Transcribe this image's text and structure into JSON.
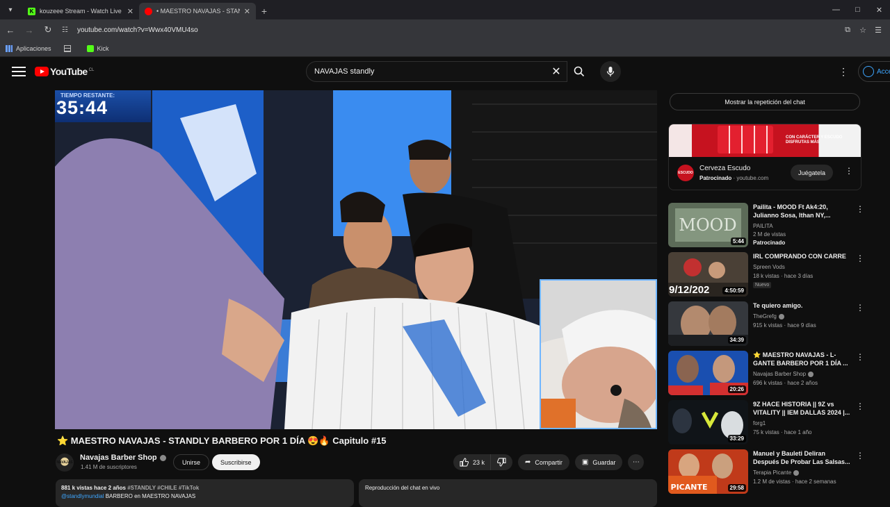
{
  "browser": {
    "tabs": [
      {
        "title": "kouzeee Stream - Watch Live o",
        "active": false
      },
      {
        "title": "• MAESTRO NAVAJAS - STANDL",
        "active": true
      }
    ],
    "url": "youtube.com/watch?v=Wwx40VMU4so",
    "bookmarks": [
      {
        "label": "Aplicaciones",
        "icon": "apps-icon"
      },
      {
        "label": "",
        "icon": "grid-icon"
      },
      {
        "label": "Kick",
        "icon": "kick-icon"
      }
    ]
  },
  "youtube": {
    "logo_text": "YouTube",
    "country": "CL",
    "search_value": "NAVAJAS standly",
    "signin_label": "Acce"
  },
  "video": {
    "timer_label": "TIEMPO RESTANTE:",
    "timer_value": "35:44",
    "title": "⭐ MAESTRO NAVAJAS - STANDLY BARBERO POR 1 DÍA 😍🔥 Capitulo #15",
    "channel": "Navajas Barber Shop",
    "subscribers": "1.41 M de suscriptores",
    "join_label": "Unirse",
    "subscribe_label": "Suscribirse",
    "likes": "23 k",
    "share_label": "Compartir",
    "save_label": "Guardar",
    "desc_meta": "881 k vistas  hace 2 años",
    "desc_tags": "#STANDLY #CHILE #TikTok",
    "desc_mention": "@standlymundial",
    "desc_rest": "BARBERO en MAESTRO NAVAJAS",
    "livechat_label": "Reproducción del chat en vivo"
  },
  "sidebar": {
    "chat_replay_label": "Mostrar la repetición del chat",
    "ad": {
      "banner_text": "CON CARÁCTER Y ESCUDO DISFRUTAS MÁS",
      "logo_text": "ESCUDO",
      "title": "Cerveza Escudo",
      "sponsored": "Patrocinado",
      "domain": "youtube.com",
      "cta": "Juégatela"
    },
    "recommendations": [
      {
        "title": "Pailita - MOOD Ft Ak4:20, Julianno Sosa, Ithan NY,...",
        "channel": "PAILITA",
        "meta": "2 M de vistas",
        "extra": "Patrocinado",
        "duration": "5:44",
        "verified": false
      },
      {
        "title": "IRL COMPRANDO CON CARRE",
        "channel": "Spreen Vods",
        "meta": "18 k vistas · hace 3 días",
        "extra": "Nuevo",
        "duration": "4:50:59",
        "verified": false
      },
      {
        "title": "Te quiero amigo.",
        "channel": "TheGrefg",
        "meta": "915 k vistas · hace 9 días",
        "extra": "",
        "duration": "34:39",
        "verified": true
      },
      {
        "title": "⭐ MAESTRO NAVAJAS - L-GANTE BARBERO POR 1 DÍA ...",
        "channel": "Navajas Barber Shop",
        "meta": "696 k vistas · hace 2 años",
        "extra": "",
        "duration": "20:26",
        "verified": true
      },
      {
        "title": "9Z HACE HISTORIA || 9Z vs VITALITY || IEM DALLAS 2024 |...",
        "channel": "forg1",
        "meta": "75 k vistas · hace 1 año",
        "extra": "",
        "duration": "33:29",
        "verified": false
      },
      {
        "title": "Manuel y Bauleti Deliran Después De Probar Las Salsas...",
        "channel": "Terapia Picante",
        "meta": "1.2 M de vistas · hace 2 semanas",
        "extra": "",
        "duration": "29:58",
        "verified": true
      }
    ],
    "thumb_overlay_date": "9/12/202"
  }
}
